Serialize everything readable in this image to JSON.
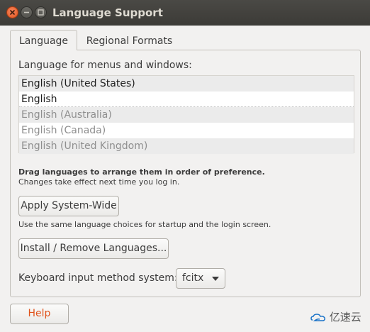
{
  "window": {
    "title": "Language Support"
  },
  "tabs": [
    {
      "label": "Language",
      "active": true
    },
    {
      "label": "Regional Formats",
      "active": false
    }
  ],
  "language_section": {
    "heading": "Language for menus and windows:",
    "languages": [
      "English (United States)",
      "English",
      "English (Australia)",
      "English (Canada)",
      "English (United Kingdom)"
    ],
    "drag_hint": "Drag languages to arrange them in order of preference.",
    "changes_note": "Changes take effect next time you log in."
  },
  "buttons": {
    "apply_system_wide": "Apply System-Wide",
    "install_remove": "Install / Remove Languages...",
    "help": "Help"
  },
  "apply_note": "Use the same language choices for startup and the login screen.",
  "keyboard": {
    "label": "Keyboard input method system:",
    "selected": "fcitx"
  },
  "watermark": {
    "text": "亿速云"
  },
  "colors": {
    "close_button": "#e0531c",
    "titlebar": "#3c3b37",
    "help_text": "#e0531c"
  }
}
